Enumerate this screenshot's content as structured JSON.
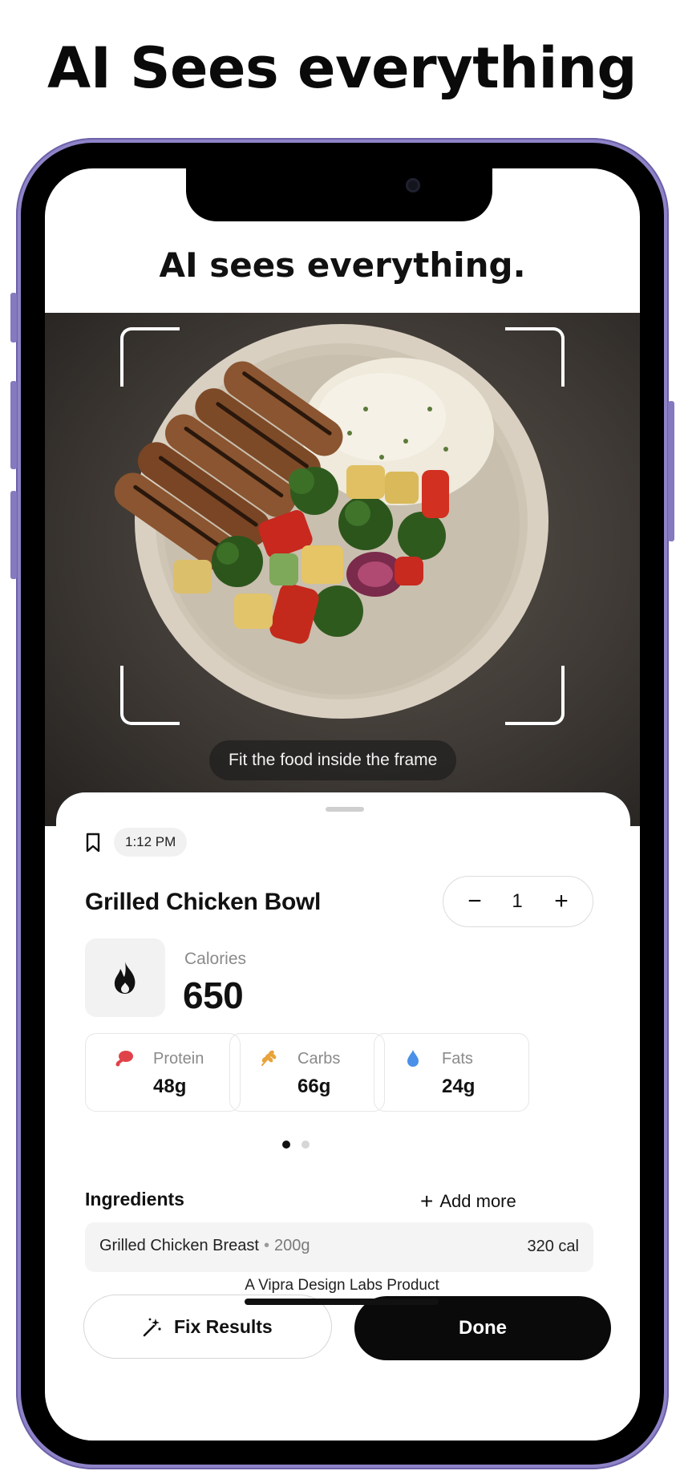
{
  "headline": "AI Sees everything",
  "app": {
    "title": "AI sees everything.",
    "frame_hint": "Fit the food inside the frame",
    "time": "1:12 PM",
    "meal_name": "Grilled Chicken Bowl",
    "quantity": "1",
    "stepper": {
      "minus": "−",
      "plus": "+"
    },
    "calories": {
      "label": "Calories",
      "value": "650"
    },
    "macros": [
      {
        "label": "Protein",
        "value": "48g",
        "icon": "meat-icon",
        "color": "#e0424a"
      },
      {
        "label": "Carbs",
        "value": "66g",
        "icon": "wheat-icon",
        "color": "#e8a33a"
      },
      {
        "label": "Fats",
        "value": "24g",
        "icon": "droplet-icon",
        "color": "#4a90e8"
      }
    ],
    "pager": {
      "pages": 2,
      "active": 1
    },
    "ingredients": {
      "title": "Ingredients",
      "add_more": "Add more",
      "items": [
        {
          "name": "Grilled Chicken Breast",
          "separator": "•",
          "amount": "200g",
          "calories": "320 cal"
        }
      ]
    },
    "fix_button": "Fix Results",
    "done_button": "Done"
  },
  "credit": "A Vipra Design Labs Product",
  "colors": {
    "frame": "#8f83c8",
    "accent_dark": "#0a0a0a"
  }
}
